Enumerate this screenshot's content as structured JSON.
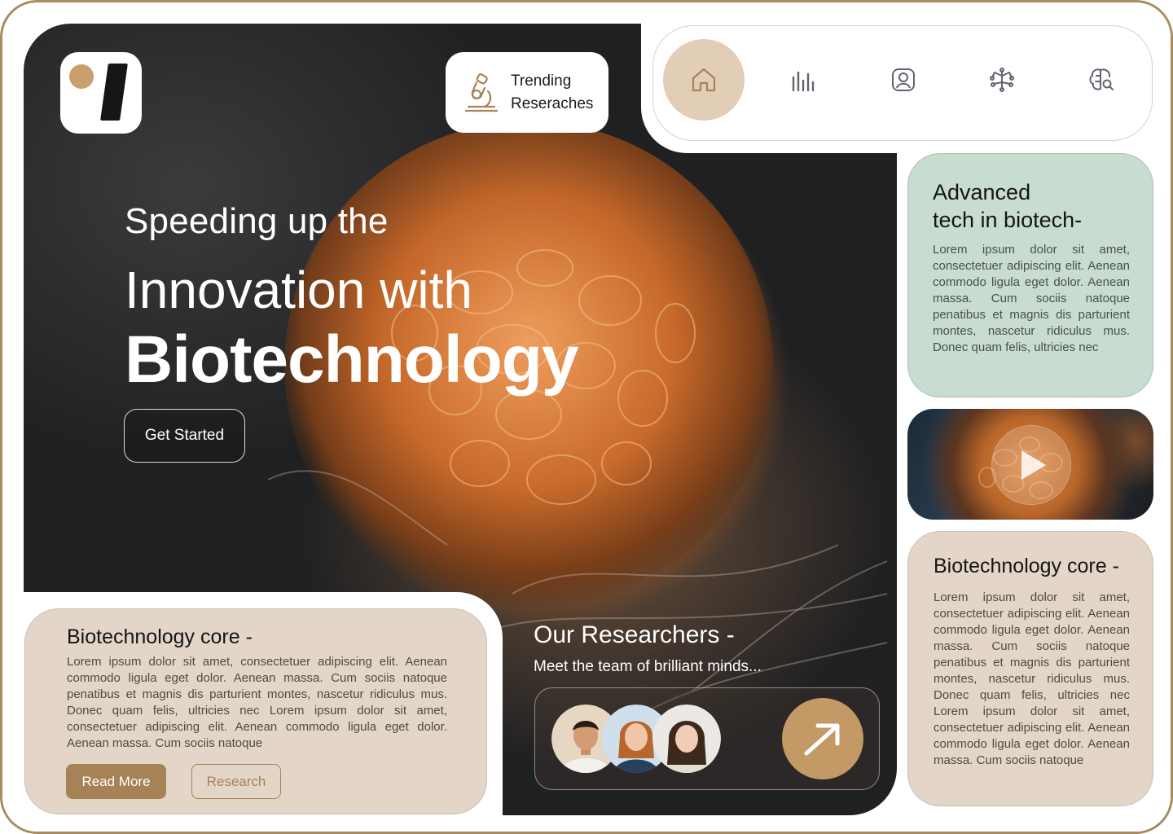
{
  "brand": {
    "accent": "#c39a66",
    "dark_accent": "#a78256",
    "green_card": "#c8dcd0",
    "beige_card": "#e3d6c8"
  },
  "logo": {
    "icon": "brand-logo"
  },
  "trending": {
    "line1": "Trending",
    "line2": "Reseraches",
    "icon": "microscope-icon"
  },
  "hero": {
    "line1": "Speeding up the",
    "line2": "Innovation with",
    "line3": "Biotechnology",
    "cta": "Get Started"
  },
  "nav": {
    "items": [
      {
        "icon": "home-icon",
        "active": true
      },
      {
        "icon": "bar-chart-icon",
        "active": false
      },
      {
        "icon": "user-profile-icon",
        "active": false
      },
      {
        "icon": "molecule-icon",
        "active": false
      },
      {
        "icon": "brain-search-icon",
        "active": false
      }
    ]
  },
  "card_advanced": {
    "title1": "Advanced",
    "title2": "tech in biotech-",
    "body": "Lorem ipsum dolor sit amet, consectetuer adipiscing elit. Aenean commodo ligula eget dolor. Aenean massa. Cum sociis natoque penatibus et magnis dis parturient montes, nascetur ridiculus mus. Donec quam felis, ultricies nec"
  },
  "video": {
    "icon": "play-icon"
  },
  "card_core_right": {
    "title": "Biotechnology core -",
    "body": "Lorem ipsum dolor sit amet, consectetuer adipiscing elit. Aenean commodo ligula eget dolor. Aenean massa. Cum sociis natoque penatibus et magnis dis parturient montes, nascetur ridiculus mus. Donec quam felis, ultricies nec Lorem ipsum dolor sit amet, consectetuer adipiscing elit. Aenean commodo ligula eget dolor. Aenean massa. Cum sociis natoque"
  },
  "card_core_left": {
    "title": "Biotechnology core -",
    "body": "Lorem ipsum dolor sit amet, consectetuer adipiscing elit. Aenean commodo ligula eget dolor. Aenean massa. Cum sociis natoque penatibus et magnis dis parturient montes, nascetur ridiculus mus. Donec quam felis, ultricies nec Lorem ipsum dolor sit amet, consectetuer adipiscing elit. Aenean commodo ligula eget dolor. Aenean massa. Cum sociis natoque",
    "read_more": "Read More",
    "research": "Research"
  },
  "researchers": {
    "title": "Our Researchers -",
    "subtitle": "Meet the team of brilliant minds...",
    "avatars": [
      "avatar-man",
      "avatar-woman-redhead",
      "avatar-woman-brunette"
    ],
    "icon": "arrow-up-right-icon"
  }
}
